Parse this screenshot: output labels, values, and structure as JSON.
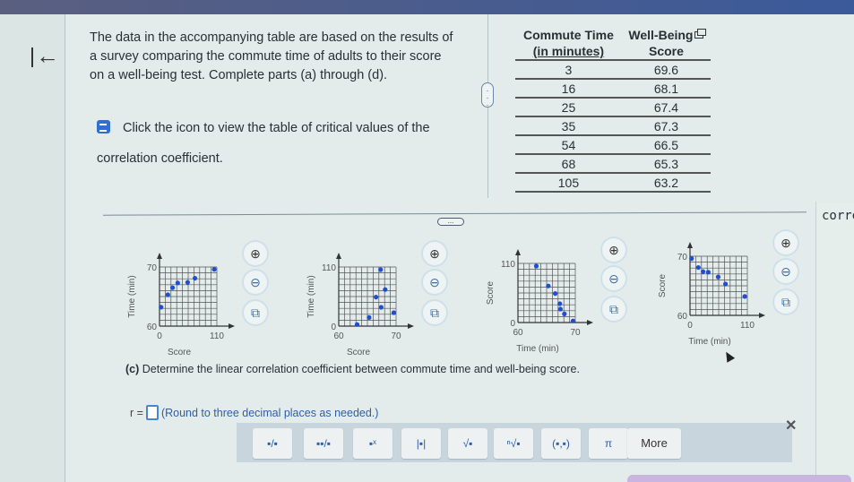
{
  "navigation": {
    "back_label": "back"
  },
  "intro": {
    "text": "The data in the accompanying table are based on the results of a survey comparing the commute time of adults to their score on a well-being test. Complete parts (a) through (d).",
    "note": "Click the icon to view the table of critical values of the correlation coefficient."
  },
  "table": {
    "headers": [
      {
        "line1": "Commute Time",
        "line2": "(in minutes)"
      },
      {
        "line1": "Well-Being",
        "line2": "Score"
      }
    ],
    "rows": [
      [
        "3",
        "69.6"
      ],
      [
        "16",
        "68.1"
      ],
      [
        "25",
        "67.4"
      ],
      [
        "35",
        "67.3"
      ],
      [
        "54",
        "66.5"
      ],
      [
        "68",
        "65.3"
      ],
      [
        "105",
        "63.2"
      ]
    ]
  },
  "handles": {
    "splitter": "..."
  },
  "right_panel": {
    "truncated_text": "corre"
  },
  "chart_data": [
    {
      "type": "scatter",
      "option": 1,
      "xlabel": "Score",
      "ylabel": "Time (min)",
      "xlim": [
        0,
        110
      ],
      "ylim": [
        60,
        70
      ],
      "xticks": [
        "0",
        "110"
      ],
      "yticks": [
        "60",
        "70"
      ],
      "points": [
        [
          3,
          63.2
        ],
        [
          16,
          65.3
        ],
        [
          25,
          66.5
        ],
        [
          35,
          67.3
        ],
        [
          54,
          67.4
        ],
        [
          68,
          68.1
        ],
        [
          105,
          69.6
        ]
      ]
    },
    {
      "type": "scatter",
      "option": 2,
      "xlabel": "Score",
      "ylabel": "Time (min)",
      "xlim": [
        60,
        70
      ],
      "ylim": [
        0,
        110
      ],
      "xticks": [
        "60",
        "70"
      ],
      "yticks": [
        "0",
        "110"
      ],
      "points": [
        [
          63.2,
          3
        ],
        [
          65.3,
          16
        ],
        [
          69.6,
          25
        ],
        [
          67.4,
          35
        ],
        [
          66.5,
          54
        ],
        [
          68.1,
          68
        ],
        [
          67.3,
          105
        ]
      ]
    },
    {
      "type": "scatter",
      "option": 3,
      "xlabel": "Time (min)",
      "ylabel": "Score",
      "xlim": [
        60,
        70
      ],
      "ylim": [
        0,
        110
      ],
      "xticks": [
        "60",
        "70"
      ],
      "yticks": [
        "0",
        "110"
      ],
      "points": [
        [
          63.2,
          105
        ],
        [
          65.3,
          68
        ],
        [
          66.5,
          54
        ],
        [
          67.3,
          35
        ],
        [
          67.4,
          25
        ],
        [
          68.1,
          16
        ],
        [
          69.6,
          3
        ]
      ]
    },
    {
      "type": "scatter",
      "option": 4,
      "xlabel": "Time (min)",
      "ylabel": "Score",
      "xlim": [
        0,
        110
      ],
      "ylim": [
        60,
        70
      ],
      "xticks": [
        "0",
        "110"
      ],
      "yticks": [
        "60",
        "70"
      ],
      "points": [
        [
          3,
          69.6
        ],
        [
          16,
          68.1
        ],
        [
          25,
          67.4
        ],
        [
          35,
          67.3
        ],
        [
          54,
          66.5
        ],
        [
          68,
          65.3
        ],
        [
          105,
          63.2
        ]
      ]
    }
  ],
  "plot_tools": {
    "zoom_in": "zoom-in",
    "zoom_out": "zoom-out",
    "popout": "open-in-new-window"
  },
  "part_c": {
    "label": "(c)",
    "question": "Determine the linear correlation coefficient between commute time and well-being score.",
    "answer_prefix": "r =",
    "answer_value": "",
    "hint": "(Round to three decimal places as needed.)"
  },
  "math_toolbar": {
    "buttons": [
      {
        "name": "fraction",
        "glyph": "▪/▪"
      },
      {
        "name": "mixed-number",
        "glyph": "▪▪/▪"
      },
      {
        "name": "exponent",
        "glyph": "▪ˣ"
      },
      {
        "name": "absolute-value",
        "glyph": "|▪|"
      },
      {
        "name": "square-root",
        "glyph": "√▪"
      },
      {
        "name": "nth-root",
        "glyph": "ⁿ√▪"
      },
      {
        "name": "ordered-pair",
        "glyph": "(▪,▪)"
      },
      {
        "name": "pi",
        "glyph": "π"
      },
      {
        "name": "more",
        "glyph": "More"
      }
    ],
    "close_glyph": "✕"
  }
}
